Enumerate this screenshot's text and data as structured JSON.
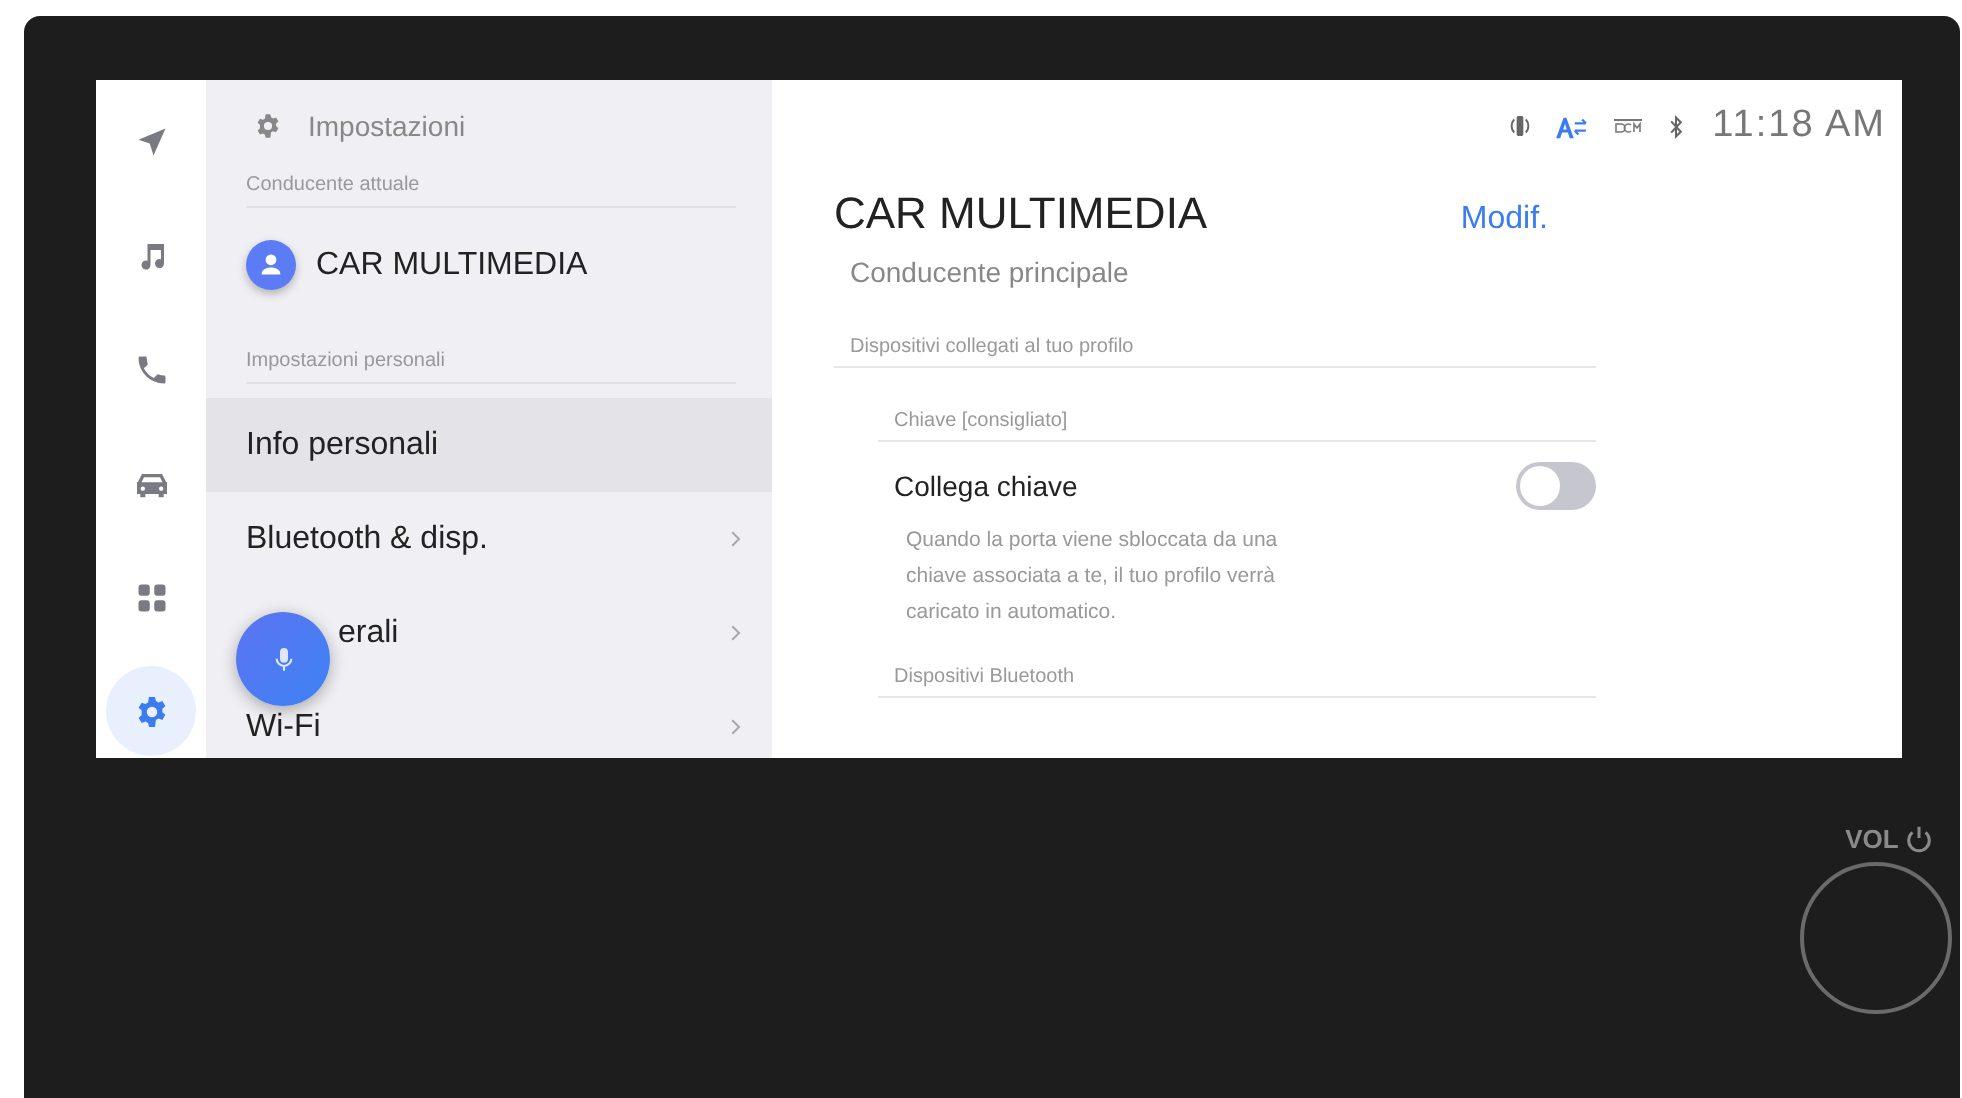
{
  "rail": [
    {
      "kind": "navigation",
      "selected": false
    },
    {
      "kind": "music",
      "selected": false
    },
    {
      "kind": "phone",
      "selected": false
    },
    {
      "kind": "car",
      "selected": false
    },
    {
      "kind": "apps",
      "selected": false
    },
    {
      "kind": "settings",
      "selected": true
    }
  ],
  "sidebar": {
    "title": "Impostazioni",
    "current_driver_label": "Conducente attuale",
    "driver_name": "CAR MULTIMEDIA",
    "personal_label": "Impostazioni personali",
    "items": [
      {
        "label": "Info personali",
        "selected": true,
        "chevron": false
      },
      {
        "label": "Bluetooth & disp.",
        "selected": false,
        "chevron": true
      },
      {
        "label": "erali",
        "selected": false,
        "chevron": true,
        "partly_covered": true
      },
      {
        "label": "Wi-Fi",
        "selected": false,
        "chevron": true
      }
    ]
  },
  "status_bar": {
    "time": "11:18 AM"
  },
  "profile": {
    "name": "CAR MULTIMEDIA",
    "edit_link": "Modif.",
    "role": "Conducente principale",
    "section_label": "Dispositivi collegati al tuo profilo",
    "key_section_label": "Chiave [consigliato]",
    "key_link": {
      "label": "Collega chiave",
      "on": false,
      "description": "Quando la porta viene sbloccata da una chiave associata a te, il tuo profilo verrà caricato in automatico."
    },
    "bluetooth_label": "Dispositivi Bluetooth"
  },
  "device": {
    "vol_label": "VOL"
  }
}
